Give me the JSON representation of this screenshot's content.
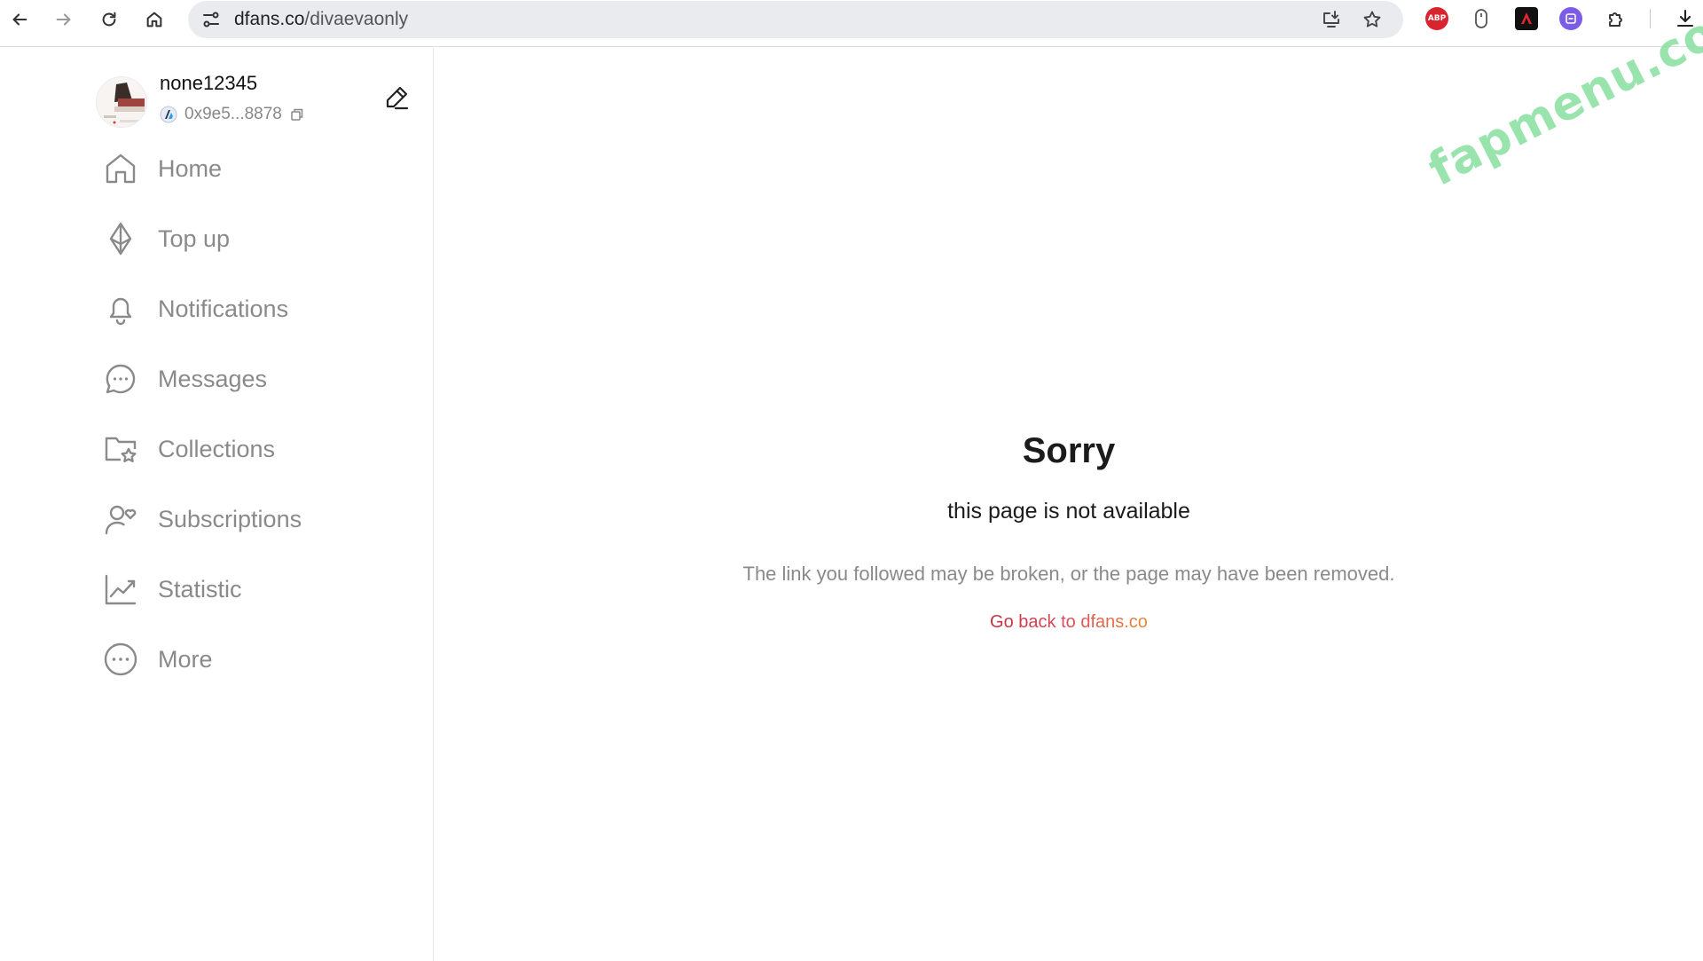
{
  "browser": {
    "url_host": "dfans.co",
    "url_path": "/divaevaonly",
    "extensions": {
      "adblock_label": "ABP"
    }
  },
  "profile": {
    "username": "none12345",
    "wallet": "0x9e5...8878"
  },
  "menu": [
    {
      "label": "Home",
      "icon": "home-icon"
    },
    {
      "label": "Top up",
      "icon": "ethereum-icon"
    },
    {
      "label": "Notifications",
      "icon": "bell-icon"
    },
    {
      "label": "Messages",
      "icon": "chat-bubble-icon"
    },
    {
      "label": "Collections",
      "icon": "folder-star-icon"
    },
    {
      "label": "Subscriptions",
      "icon": "person-heart-icon"
    },
    {
      "label": "Statistic",
      "icon": "chart-line-icon"
    },
    {
      "label": "More",
      "icon": "more-dots-icon"
    }
  ],
  "error": {
    "title": "Sorry",
    "subtitle": "this page is not available",
    "description": "The link you followed may be broken, or the page may have been removed.",
    "link_label": "Go back to dfans.co"
  },
  "watermark": "fapmenu.com",
  "colors": {
    "menu_text": "#8a8a8a",
    "link_gradient_start": "#c62f3d",
    "link_gradient_end": "#e88a3c",
    "watermark": "#8fe0a4"
  }
}
